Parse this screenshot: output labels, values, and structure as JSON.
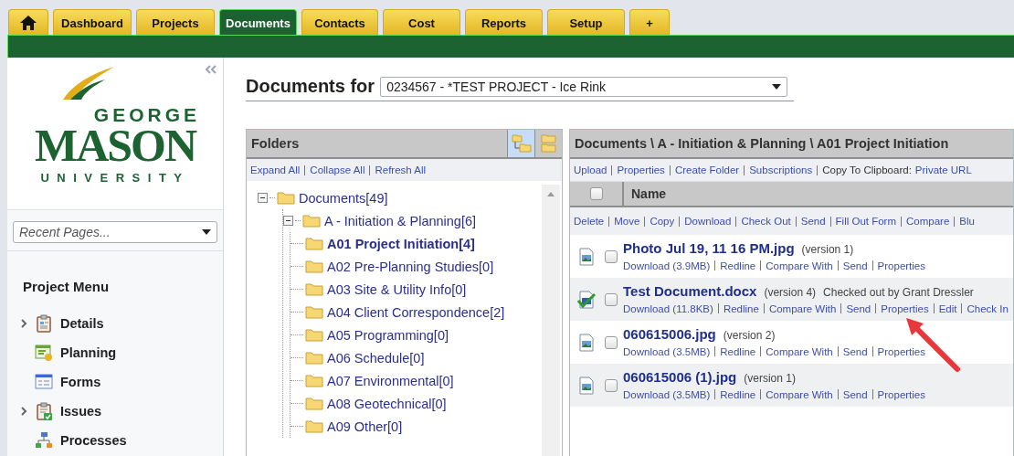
{
  "nav_tabs": [
    {
      "kind": "home",
      "selected": false
    },
    {
      "kind": "text",
      "label": "Dashboard",
      "selected": false
    },
    {
      "kind": "text",
      "label": "Projects",
      "selected": false
    },
    {
      "kind": "text",
      "label": "Documents",
      "selected": true
    },
    {
      "kind": "text",
      "label": "Contacts",
      "selected": false
    },
    {
      "kind": "text",
      "label": "Cost",
      "selected": false
    },
    {
      "kind": "text",
      "label": "Reports",
      "selected": false
    },
    {
      "kind": "text",
      "label": "Setup",
      "selected": false
    },
    {
      "kind": "text",
      "label": "+",
      "selected": false
    }
  ],
  "sidebar": {
    "logo": {
      "line_1": "GEORGE",
      "line_2": "MASON",
      "line_3": "UNIVERSITY"
    },
    "recent_pages": {
      "placeholder": "Recent Pages..."
    },
    "menu_title": "Project Menu",
    "menu_items": [
      {
        "label": "Details",
        "kind": "details",
        "expandable": true
      },
      {
        "label": "Planning",
        "kind": "planning",
        "expandable": false
      },
      {
        "label": "Forms",
        "kind": "forms",
        "expandable": false
      },
      {
        "label": "Issues",
        "kind": "issues",
        "expandable": true
      },
      {
        "label": "Processes",
        "kind": "processes",
        "expandable": false
      }
    ]
  },
  "header": {
    "title": "Documents for",
    "project": "0234567 - *TEST PROJECT - Ice Rink"
  },
  "folders": {
    "title": "Folders",
    "links": [
      "Expand All",
      "Collapse All",
      "Refresh All"
    ],
    "tree": [
      {
        "label": "Documents[49]",
        "expanded": true,
        "selected": false,
        "children": [
          {
            "label": "A - Initiation & Planning[6]",
            "expanded": true,
            "selected": false,
            "children": [
              {
                "label": "A01 Project Initiation[4]",
                "selected": true
              },
              {
                "label": "A02 Pre-Planning Studies[0]",
                "selected": false
              },
              {
                "label": "A03 Site & Utility Info[0]",
                "selected": false
              },
              {
                "label": "A04 Client Correspondence[2]",
                "selected": false
              },
              {
                "label": "A05 Programming[0]",
                "selected": false
              },
              {
                "label": "A06 Schedule[0]",
                "selected": false
              },
              {
                "label": "A07 Environmental[0]",
                "selected": false
              },
              {
                "label": "A08 Geotechnical[0]",
                "selected": false
              },
              {
                "label": "A09 Other[0]",
                "selected": false
              }
            ]
          }
        ]
      }
    ]
  },
  "documents": {
    "path": "Documents \\ A - Initiation & Planning \\ A01 Project Initiation",
    "folder_links": [
      "Upload",
      "Properties",
      "Create Folder",
      "Subscriptions"
    ],
    "clipboard": {
      "label": "Copy To Clipboard:",
      "link": "Private URL"
    },
    "select_all_checked": false,
    "column": "Name",
    "actions": [
      "Delete",
      "Move",
      "Copy",
      "Download",
      "Check Out",
      "Send",
      "Fill Out Form",
      "Compare",
      "Blu"
    ],
    "files": [
      {
        "name": "Photo Jul 19, 11 16 PM.jpg",
        "version": "(version 1)",
        "checked_out": false,
        "checked": false,
        "links": [
          "Download (3.9MB)",
          "Redline",
          "Compare With",
          "Send",
          "Properties"
        ]
      },
      {
        "name": "Test Document.docx",
        "version": "(version 4)",
        "status": "Checked out by Grant Dressler",
        "checked_out": true,
        "checked": false,
        "links": [
          "Download (11.8KB)",
          "Redline",
          "Compare With",
          "Send",
          "Properties",
          "Edit",
          "Check In"
        ]
      },
      {
        "name": "060615006.jpg",
        "version": "(version 2)",
        "checked_out": false,
        "checked": false,
        "links": [
          "Download (3.5MB)",
          "Redline",
          "Compare With",
          "Send",
          "Properties"
        ]
      },
      {
        "name": "060615006 (1).jpg",
        "version": "(version 1)",
        "checked_out": false,
        "checked": false,
        "links": [
          "Download (3.5MB)",
          "Redline",
          "Compare With",
          "Send",
          "Properties"
        ]
      }
    ]
  }
}
